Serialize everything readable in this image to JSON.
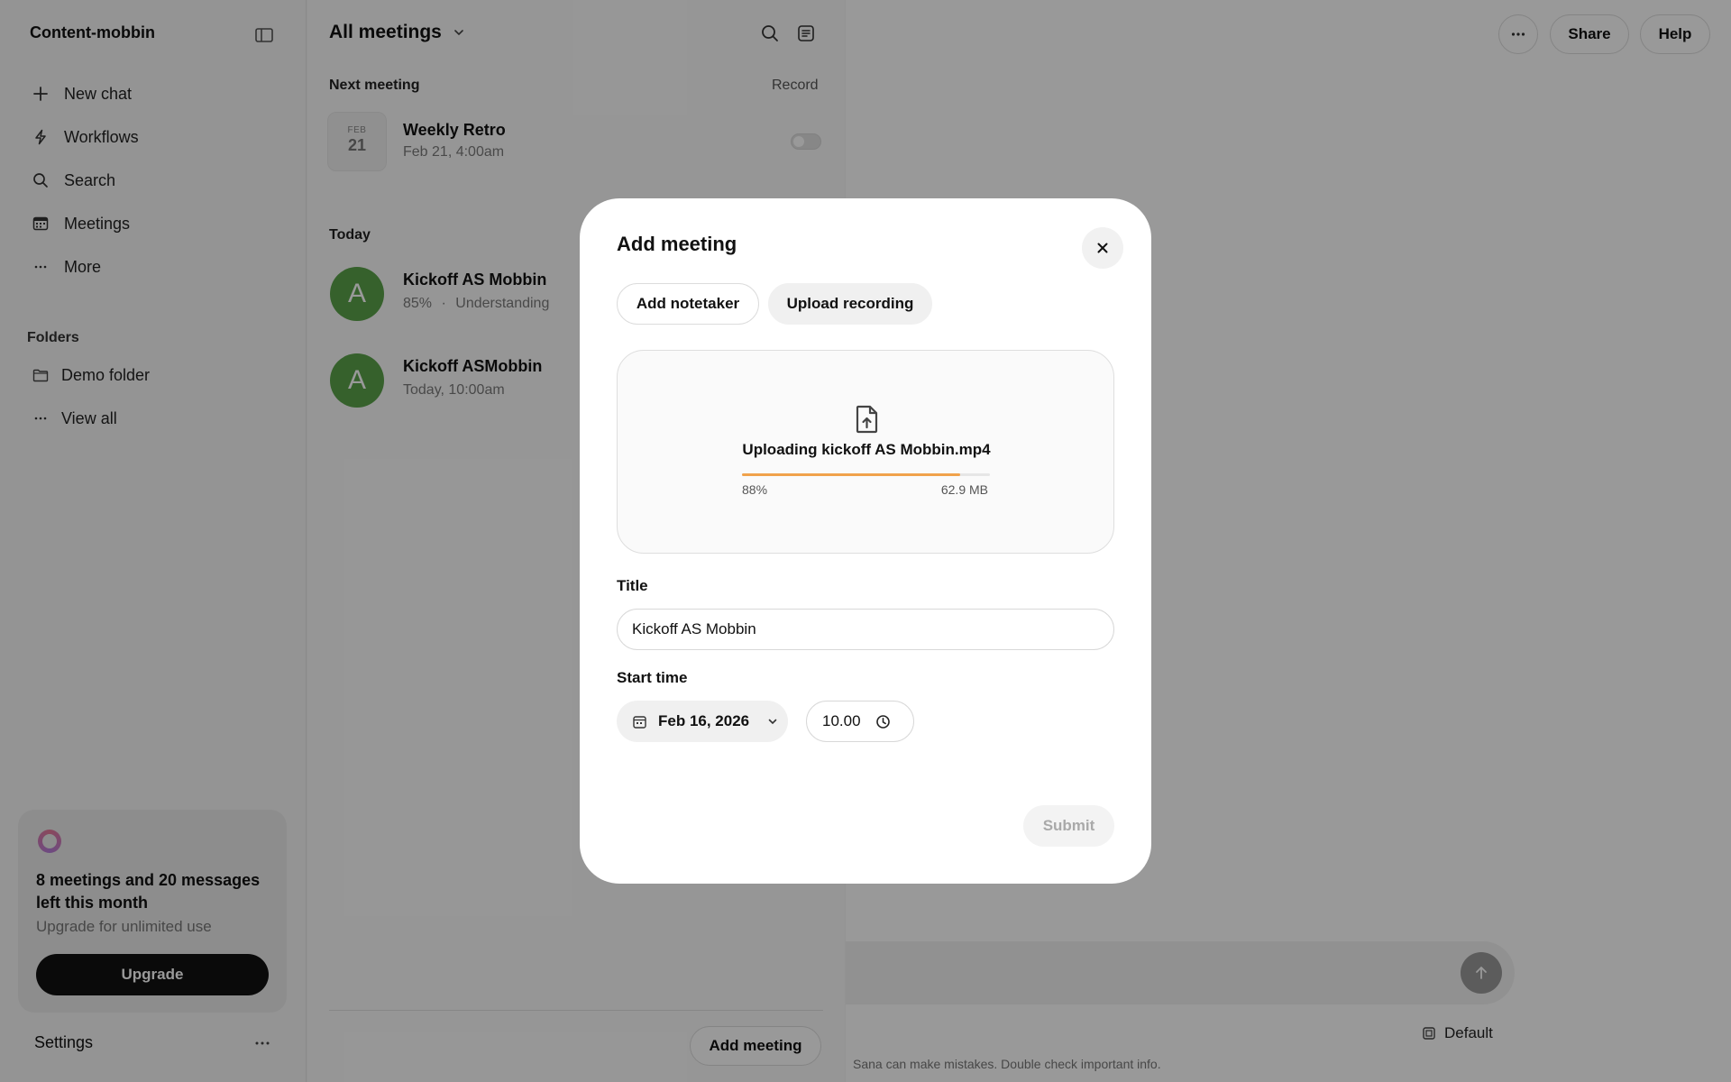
{
  "sidebar": {
    "workspace_name": "Content-mobbin",
    "nav_items": [
      {
        "label": "New chat",
        "icon": "plus-icon"
      },
      {
        "label": "Workflows",
        "icon": "lightning-icon"
      },
      {
        "label": "Search",
        "icon": "search-icon"
      },
      {
        "label": "Meetings",
        "icon": "calendar-icon"
      },
      {
        "label": "More",
        "icon": "more-dots-icon"
      }
    ],
    "folders_label": "Folders",
    "folders": [
      {
        "label": "Demo folder",
        "icon": "folder-icon"
      },
      {
        "label": "View all",
        "icon": "more-dots-icon"
      }
    ],
    "usage": {
      "message": "8 meetings and 20 messages left this month",
      "sub": "Upgrade for unlimited use",
      "button": "Upgrade"
    },
    "settings_label": "Settings"
  },
  "meetings_list": {
    "title": "All meetings",
    "next_label": "Next meeting",
    "record_label": "Record",
    "next_meeting": {
      "month": "FEB",
      "day": "21",
      "title": "Weekly Retro",
      "time": "Feb 21, 4:00am",
      "record_enabled": false
    },
    "today_label": "Today",
    "today": [
      {
        "avatar": "A",
        "title": "Kickoff AS Mobbin",
        "progress": "85%",
        "separator": "·",
        "status": "Understanding"
      },
      {
        "avatar": "A",
        "title": "Kickoff ASMobbin",
        "time": "Today, 10:00am"
      }
    ],
    "add_button": "Add meeting"
  },
  "main": {
    "share_label": "Share",
    "help_label": "Help",
    "model_label": "Default",
    "disclaimer": "Sana can make mistakes. Double check important info."
  },
  "modal": {
    "title": "Add meeting",
    "tabs": {
      "notetaker": "Add notetaker",
      "upload": "Upload recording"
    },
    "upload": {
      "filename": "Uploading kickoff AS Mobbin.mp4",
      "progress": 0.88,
      "progress_label": "88%",
      "size": "62.9 MB"
    },
    "title_label": "Title",
    "title_value": "Kickoff AS Mobbin",
    "start_label": "Start time",
    "date_value": "Feb 16, 2026",
    "time_value": "10.00",
    "submit_label": "Submit"
  },
  "colors": {
    "accent_progress": "#f0a24b",
    "avatar_green": "#5aa24a",
    "upgrade_button": "#121212"
  }
}
